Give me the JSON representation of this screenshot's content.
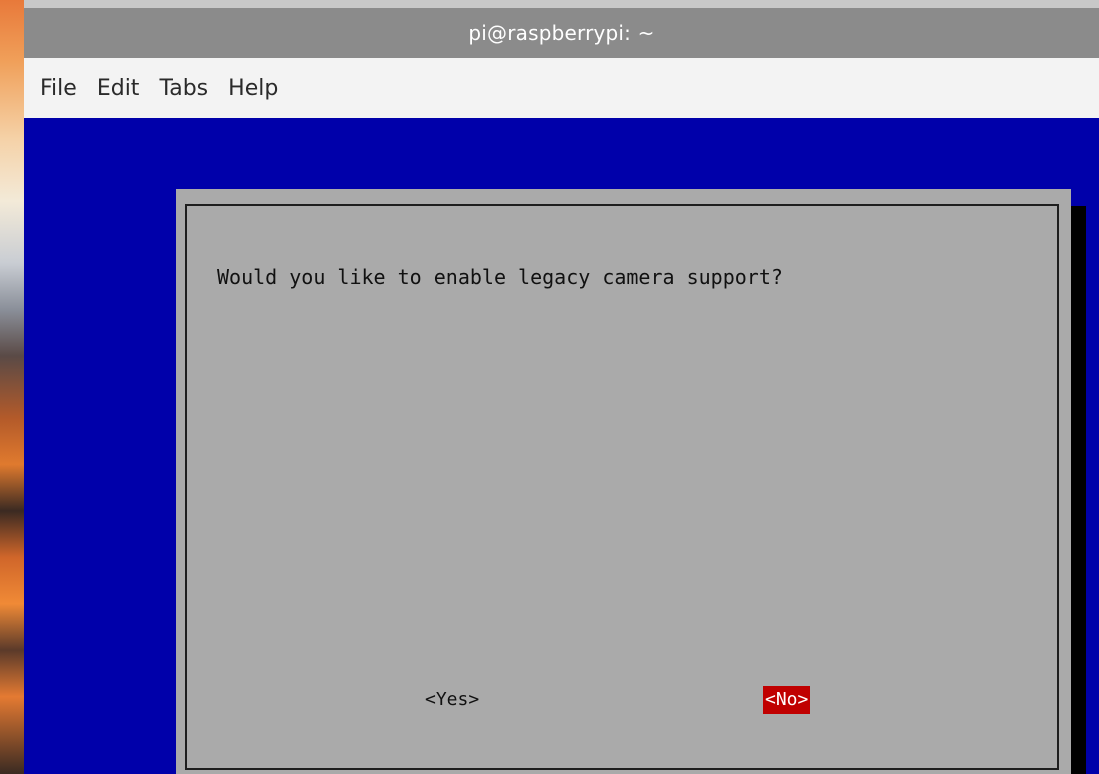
{
  "window": {
    "title": "pi@raspberrypi: ~"
  },
  "menubar": {
    "items": [
      {
        "label": "File"
      },
      {
        "label": "Edit"
      },
      {
        "label": "Tabs"
      },
      {
        "label": "Help"
      }
    ]
  },
  "dialog": {
    "question": "Would you like to enable legacy camera support?",
    "buttons": {
      "yes_label": "<Yes>",
      "no_label": "<No>",
      "selected": "No"
    }
  },
  "colors": {
    "terminal_background": "#0000aa",
    "dialog_background": "#aaaaaa",
    "selected_button": "#c00000",
    "titlebar": "#8b8b8b",
    "menubar": "#f3f3f3"
  }
}
